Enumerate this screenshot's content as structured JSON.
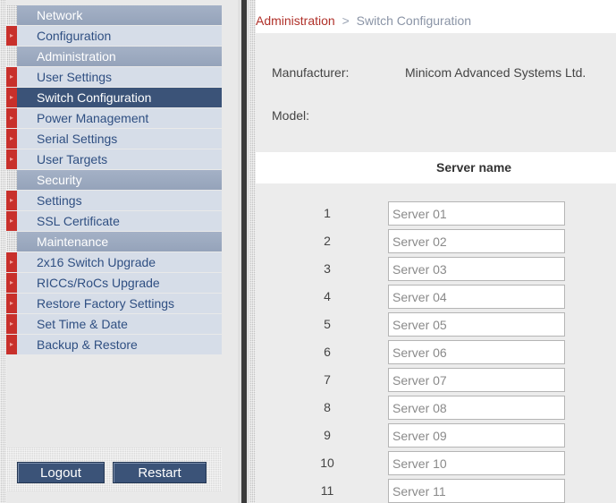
{
  "sidebar": {
    "sections": [
      {
        "title": "Network",
        "items": [
          "Configuration"
        ]
      },
      {
        "title": "Administration",
        "items": [
          "User Settings",
          "Switch Configuration",
          "Power Management",
          "Serial Settings",
          "User Targets"
        ]
      },
      {
        "title": "Security",
        "items": [
          "Settings",
          "SSL Certificate"
        ]
      },
      {
        "title": "Maintenance",
        "items": [
          "2x16 Switch Upgrade",
          "RICCs/RoCs Upgrade",
          "Restore Factory Settings",
          "Set Time & Date",
          "Backup & Restore"
        ]
      }
    ],
    "selected_item": "Switch Configuration",
    "logout_label": "Logout",
    "restart_label": "Restart"
  },
  "breadcrumb": {
    "root": "Administration",
    "separator": ">",
    "current": "Switch Configuration"
  },
  "info": {
    "manufacturer_label": "Manufacturer:",
    "manufacturer_value": "Minicom Advanced Systems Ltd.",
    "model_label": "Model:"
  },
  "server_table": {
    "header": "Server name",
    "rows": [
      {
        "number": "1",
        "name": "Server 01"
      },
      {
        "number": "2",
        "name": "Server 02"
      },
      {
        "number": "3",
        "name": "Server 03"
      },
      {
        "number": "4",
        "name": "Server 04"
      },
      {
        "number": "5",
        "name": "Server 05"
      },
      {
        "number": "6",
        "name": "Server 06"
      },
      {
        "number": "7",
        "name": "Server 07"
      },
      {
        "number": "8",
        "name": "Server 08"
      },
      {
        "number": "9",
        "name": "Server 09"
      },
      {
        "number": "10",
        "name": "Server 10"
      },
      {
        "number": "11",
        "name": "Server 11"
      }
    ]
  },
  "colors": {
    "section_header_bg": "#9aa7bd",
    "menu_item_bg": "#d6dde8",
    "menu_item_text": "#2f4f82",
    "selected_bg": "#3b5378",
    "marker_red": "#c8302b",
    "breadcrumb_root": "#b0312a"
  }
}
